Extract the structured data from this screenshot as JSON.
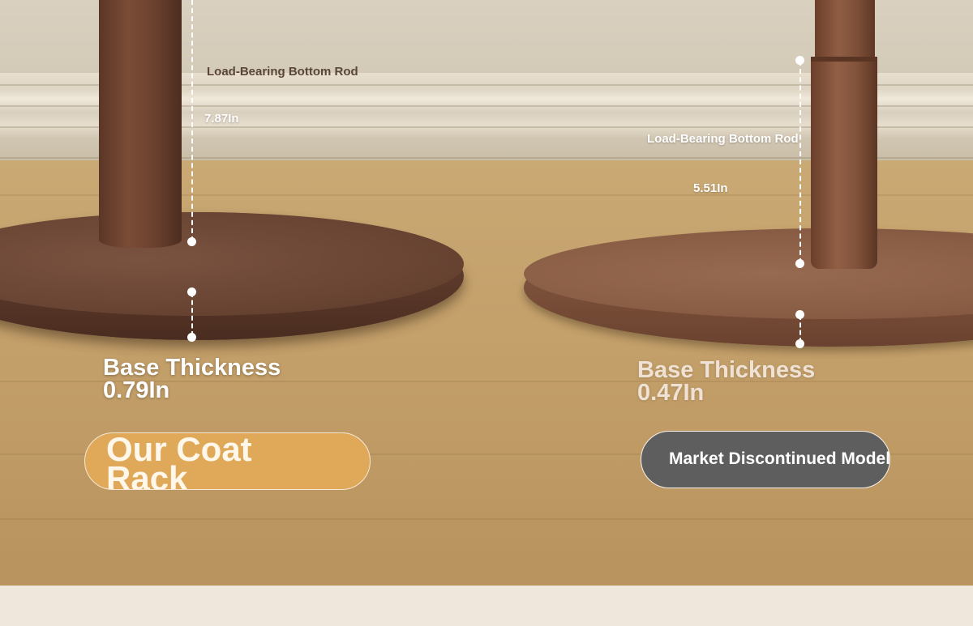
{
  "comparison": {
    "ours": {
      "rod_label": "Load-Bearing Bottom Rod",
      "rod_measure": "7.87In",
      "thickness_label": "Base Thickness",
      "thickness_value": "0.79In",
      "badge": "Our Coat Rack"
    },
    "market": {
      "rod_label": "Load-Bearing Bottom Rod",
      "rod_measure": "5.51In",
      "thickness_label": "Base Thickness",
      "thickness_value": "0.47In",
      "badge": "Market Discontinued Model"
    }
  },
  "colors": {
    "ours_badge": "#dfa959",
    "market_badge": "#5f5e5f",
    "dimension_lines": "#ffffff"
  }
}
